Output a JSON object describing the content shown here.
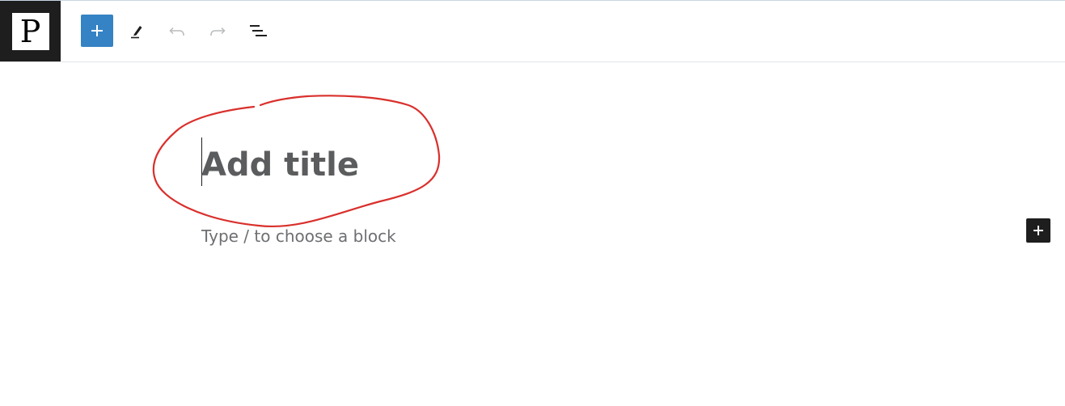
{
  "header": {
    "logo_letter": "P",
    "logo_icon": "site-logo-icon",
    "buttons": {
      "inserter_icon": "plus-icon",
      "tools_icon": "pencil-icon",
      "undo_icon": "undo-icon",
      "redo_icon": "redo-icon",
      "outline_icon": "list-view-icon"
    }
  },
  "editor": {
    "title_placeholder": "Add title",
    "block_placeholder": "Type / to choose a block",
    "add_block_icon": "plus-icon"
  },
  "colors": {
    "accent": "#3582c4",
    "dark": "#1e1e1e",
    "annotation": "#d9302c",
    "title_text": "#5b5c5e",
    "placeholder_text": "#6d6f72"
  }
}
